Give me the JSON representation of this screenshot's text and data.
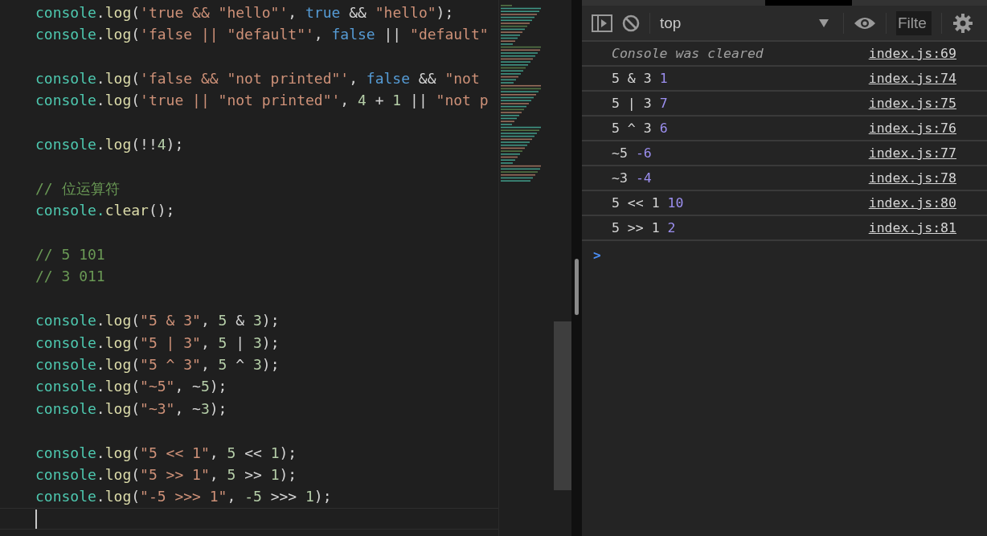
{
  "editor": {
    "lines": [
      {
        "kind": "code",
        "tokens": [
          {
            "text": "console",
            "kind": "obj"
          },
          {
            "text": ".",
            "kind": "p"
          },
          {
            "text": "log",
            "kind": "fn"
          },
          {
            "text": "(",
            "kind": "p"
          },
          {
            "text": "'true && \"hello\"'",
            "kind": "str"
          },
          {
            "text": ", ",
            "kind": "p"
          },
          {
            "text": "true",
            "kind": "kw"
          },
          {
            "text": " && ",
            "kind": "p"
          },
          {
            "text": "\"hello\"",
            "kind": "str"
          },
          {
            "text": ");",
            "kind": "p"
          }
        ]
      },
      {
        "kind": "code",
        "tokens": [
          {
            "text": "console",
            "kind": "obj"
          },
          {
            "text": ".",
            "kind": "p"
          },
          {
            "text": "log",
            "kind": "fn"
          },
          {
            "text": "(",
            "kind": "p"
          },
          {
            "text": "'false || \"default\"'",
            "kind": "str"
          },
          {
            "text": ", ",
            "kind": "p"
          },
          {
            "text": "false",
            "kind": "kw"
          },
          {
            "text": " || ",
            "kind": "p"
          },
          {
            "text": "\"default\"",
            "kind": "str"
          }
        ]
      },
      {
        "kind": "blank"
      },
      {
        "kind": "code",
        "tokens": [
          {
            "text": "console",
            "kind": "obj"
          },
          {
            "text": ".",
            "kind": "p"
          },
          {
            "text": "log",
            "kind": "fn"
          },
          {
            "text": "(",
            "kind": "p"
          },
          {
            "text": "'false && \"not printed\"'",
            "kind": "str"
          },
          {
            "text": ", ",
            "kind": "p"
          },
          {
            "text": "false",
            "kind": "kw"
          },
          {
            "text": " && ",
            "kind": "p"
          },
          {
            "text": "\"not",
            "kind": "str"
          }
        ]
      },
      {
        "kind": "code",
        "tokens": [
          {
            "text": "console",
            "kind": "obj"
          },
          {
            "text": ".",
            "kind": "p"
          },
          {
            "text": "log",
            "kind": "fn"
          },
          {
            "text": "(",
            "kind": "p"
          },
          {
            "text": "'true || \"not printed\"'",
            "kind": "str"
          },
          {
            "text": ", ",
            "kind": "p"
          },
          {
            "text": "4",
            "kind": "num"
          },
          {
            "text": " + ",
            "kind": "p"
          },
          {
            "text": "1",
            "kind": "num"
          },
          {
            "text": " || ",
            "kind": "p"
          },
          {
            "text": "\"not p",
            "kind": "str"
          }
        ]
      },
      {
        "kind": "blank"
      },
      {
        "kind": "code",
        "tokens": [
          {
            "text": "console",
            "kind": "obj"
          },
          {
            "text": ".",
            "kind": "p"
          },
          {
            "text": "log",
            "kind": "fn"
          },
          {
            "text": "(!!",
            "kind": "p"
          },
          {
            "text": "4",
            "kind": "num"
          },
          {
            "text": ");",
            "kind": "p"
          }
        ]
      },
      {
        "kind": "blank"
      },
      {
        "kind": "code",
        "tokens": [
          {
            "text": "// 位运算符",
            "kind": "cmt"
          }
        ]
      },
      {
        "kind": "code",
        "tokens": [
          {
            "text": "console.",
            "kind": "obj"
          },
          {
            "text": "clear",
            "kind": "fn"
          },
          {
            "text": "();",
            "kind": "p"
          }
        ]
      },
      {
        "kind": "blank"
      },
      {
        "kind": "code",
        "tokens": [
          {
            "text": "// 5 101",
            "kind": "cmt"
          }
        ]
      },
      {
        "kind": "code",
        "tokens": [
          {
            "text": "// 3 011",
            "kind": "cmt"
          }
        ]
      },
      {
        "kind": "blank"
      },
      {
        "kind": "code",
        "tokens": [
          {
            "text": "console",
            "kind": "obj"
          },
          {
            "text": ".",
            "kind": "p"
          },
          {
            "text": "log",
            "kind": "fn"
          },
          {
            "text": "(",
            "kind": "p"
          },
          {
            "text": "\"5 & 3\"",
            "kind": "str"
          },
          {
            "text": ", ",
            "kind": "p"
          },
          {
            "text": "5",
            "kind": "num"
          },
          {
            "text": " & ",
            "kind": "p"
          },
          {
            "text": "3",
            "kind": "num"
          },
          {
            "text": ");",
            "kind": "p"
          }
        ]
      },
      {
        "kind": "code",
        "tokens": [
          {
            "text": "console",
            "kind": "obj"
          },
          {
            "text": ".",
            "kind": "p"
          },
          {
            "text": "log",
            "kind": "fn"
          },
          {
            "text": "(",
            "kind": "p"
          },
          {
            "text": "\"5 | 3\"",
            "kind": "str"
          },
          {
            "text": ", ",
            "kind": "p"
          },
          {
            "text": "5",
            "kind": "num"
          },
          {
            "text": " | ",
            "kind": "p"
          },
          {
            "text": "3",
            "kind": "num"
          },
          {
            "text": ");",
            "kind": "p"
          }
        ]
      },
      {
        "kind": "code",
        "tokens": [
          {
            "text": "console",
            "kind": "obj"
          },
          {
            "text": ".",
            "kind": "p"
          },
          {
            "text": "log",
            "kind": "fn"
          },
          {
            "text": "(",
            "kind": "p"
          },
          {
            "text": "\"5 ^ 3\"",
            "kind": "str"
          },
          {
            "text": ", ",
            "kind": "p"
          },
          {
            "text": "5",
            "kind": "num"
          },
          {
            "text": " ^ ",
            "kind": "p"
          },
          {
            "text": "3",
            "kind": "num"
          },
          {
            "text": ");",
            "kind": "p"
          }
        ]
      },
      {
        "kind": "code",
        "tokens": [
          {
            "text": "console",
            "kind": "obj"
          },
          {
            "text": ".",
            "kind": "p"
          },
          {
            "text": "log",
            "kind": "fn"
          },
          {
            "text": "(",
            "kind": "p"
          },
          {
            "text": "\"~5\"",
            "kind": "str"
          },
          {
            "text": ", ~",
            "kind": "p"
          },
          {
            "text": "5",
            "kind": "num"
          },
          {
            "text": ");",
            "kind": "p"
          }
        ]
      },
      {
        "kind": "code",
        "tokens": [
          {
            "text": "console",
            "kind": "obj"
          },
          {
            "text": ".",
            "kind": "p"
          },
          {
            "text": "log",
            "kind": "fn"
          },
          {
            "text": "(",
            "kind": "p"
          },
          {
            "text": "\"~3\"",
            "kind": "str"
          },
          {
            "text": ", ~",
            "kind": "p"
          },
          {
            "text": "3",
            "kind": "num"
          },
          {
            "text": ");",
            "kind": "p"
          }
        ]
      },
      {
        "kind": "blank"
      },
      {
        "kind": "code",
        "tokens": [
          {
            "text": "console",
            "kind": "obj"
          },
          {
            "text": ".",
            "kind": "p"
          },
          {
            "text": "log",
            "kind": "fn"
          },
          {
            "text": "(",
            "kind": "p"
          },
          {
            "text": "\"5 << 1\"",
            "kind": "str"
          },
          {
            "text": ", ",
            "kind": "p"
          },
          {
            "text": "5",
            "kind": "num"
          },
          {
            "text": " << ",
            "kind": "p"
          },
          {
            "text": "1",
            "kind": "num"
          },
          {
            "text": ");",
            "kind": "p"
          }
        ]
      },
      {
        "kind": "code",
        "tokens": [
          {
            "text": "console",
            "kind": "obj"
          },
          {
            "text": ".",
            "kind": "p"
          },
          {
            "text": "log",
            "kind": "fn"
          },
          {
            "text": "(",
            "kind": "p"
          },
          {
            "text": "\"5 >> 1\"",
            "kind": "str"
          },
          {
            "text": ", ",
            "kind": "p"
          },
          {
            "text": "5",
            "kind": "num"
          },
          {
            "text": " >> ",
            "kind": "p"
          },
          {
            "text": "1",
            "kind": "num"
          },
          {
            "text": ");",
            "kind": "p"
          }
        ]
      },
      {
        "kind": "code",
        "tokens": [
          {
            "text": "console",
            "kind": "obj"
          },
          {
            "text": ".",
            "kind": "p"
          },
          {
            "text": "log",
            "kind": "fn"
          },
          {
            "text": "(",
            "kind": "p"
          },
          {
            "text": "\"-5 >>> 1\"",
            "kind": "str"
          },
          {
            "text": ", ",
            "kind": "p"
          },
          {
            "text": "-5",
            "kind": "num"
          },
          {
            "text": " >>> ",
            "kind": "p"
          },
          {
            "text": "1",
            "kind": "num"
          },
          {
            "text": ");",
            "kind": "p"
          }
        ]
      },
      {
        "kind": "cursor"
      }
    ]
  },
  "console": {
    "toolbar": {
      "context": "top",
      "filter_placeholder": "Filte"
    },
    "messages": [
      {
        "kind": "info",
        "text": "Console was cleared",
        "source": "index.js:69"
      },
      {
        "kind": "log",
        "text": "5 & 3",
        "value": "1",
        "source": "index.js:74"
      },
      {
        "kind": "log",
        "text": "5 | 3",
        "value": "7",
        "source": "index.js:75"
      },
      {
        "kind": "log",
        "text": "5 ^ 3",
        "value": "6",
        "source": "index.js:76"
      },
      {
        "kind": "log",
        "text": "~5",
        "value": "-6",
        "source": "index.js:77"
      },
      {
        "kind": "log",
        "text": "~3",
        "value": "-4",
        "source": "index.js:78"
      },
      {
        "kind": "log",
        "text": "5 << 1",
        "value": "10",
        "source": "index.js:80"
      },
      {
        "kind": "log",
        "text": "5 >> 1",
        "value": "2",
        "source": "index.js:81"
      }
    ],
    "prompt": ">"
  }
}
